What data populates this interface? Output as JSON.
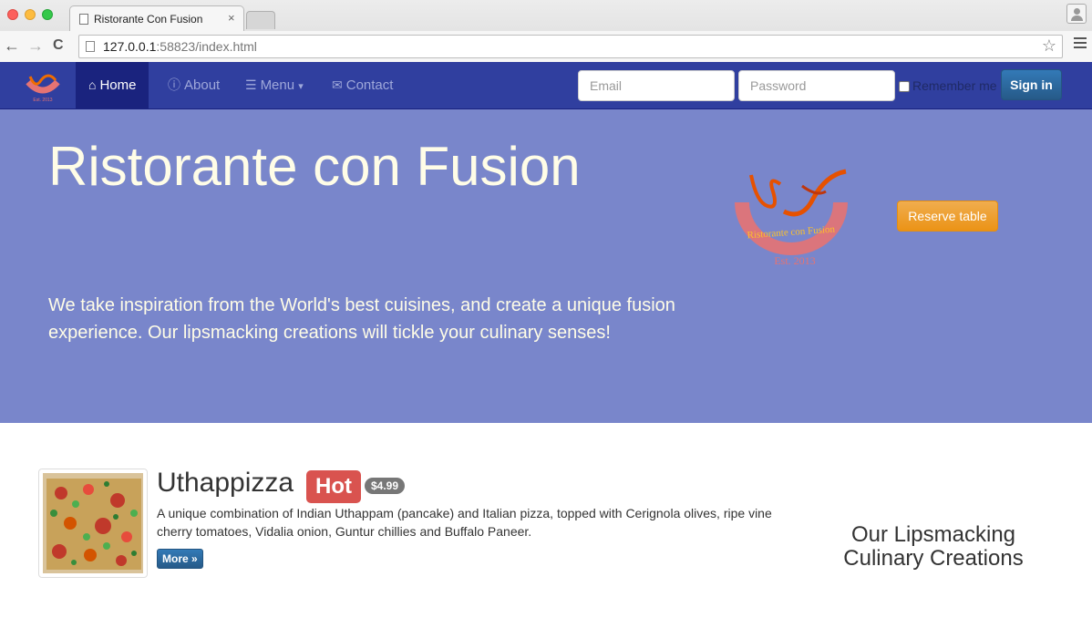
{
  "browser": {
    "tab_title": "Ristorante Con Fusion",
    "tab_close": "×",
    "url_host": "127.0.0.1",
    "url_port": ":58823",
    "url_path": "/index.html",
    "back": "←",
    "forward": "→",
    "reload": "C",
    "star": "☆"
  },
  "navbar": {
    "items": [
      {
        "label": "Home",
        "icon": "home-icon",
        "glyph": "⌂",
        "active": true
      },
      {
        "label": "About",
        "icon": "info-icon",
        "glyph": "ⓘ",
        "active": false
      },
      {
        "label": "Menu",
        "icon": "list-icon",
        "glyph": "☰",
        "active": false,
        "caret": "▾"
      },
      {
        "label": "Contact",
        "icon": "envelope-icon",
        "glyph": "✉",
        "active": false
      }
    ],
    "email_placeholder": "Email",
    "password_placeholder": "Password",
    "remember_label": "Remember me",
    "signin_label": "Sign in",
    "colors": {
      "bg": "#303f9f",
      "active": "#1a237e",
      "link": "#9fa8da"
    }
  },
  "jumbotron": {
    "title": "Ristorante con Fusion",
    "lead": "We take inspiration from the World's best cuisines, and create a unique fusion experience. Our lipsmacking creations will tickle your culinary senses!",
    "reserve_label": "Reserve table",
    "logo_text": "Ristorante con Fusion",
    "logo_est": "Est. 2013",
    "bg": "#7986cb"
  },
  "dish": {
    "name": "Uthappizza",
    "label": "Hot",
    "price": "$4.99",
    "description": "A unique combination of Indian Uthappam (pancake) and Italian pizza, topped with Cerignola olives, ripe vine cherry tomatoes, Vidalia onion, Guntur chillies and Buffalo Paneer.",
    "more_label": "More »"
  },
  "sidebar": {
    "title": "Our Lipsmacking Culinary Creations"
  }
}
